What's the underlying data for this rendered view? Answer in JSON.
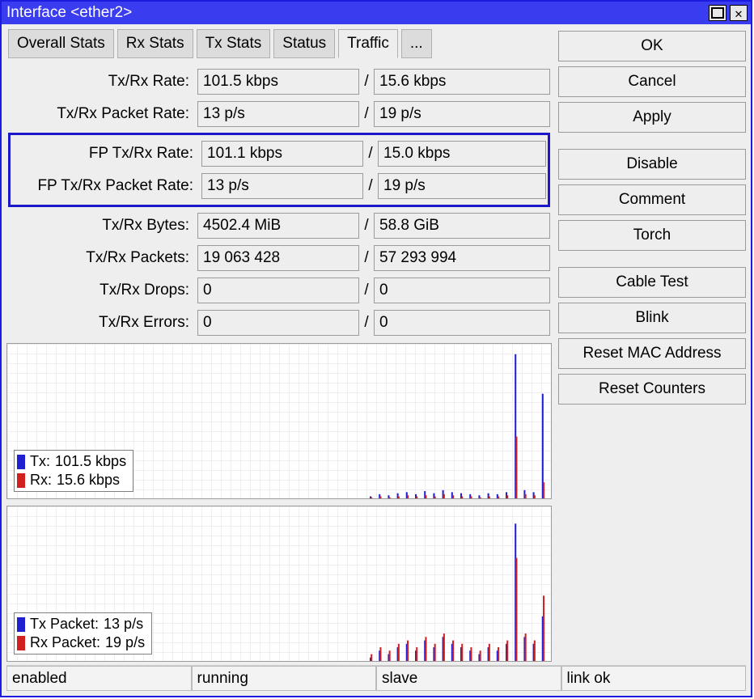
{
  "window": {
    "title": "Interface <ether2>"
  },
  "tabs": {
    "items": [
      "Overall Stats",
      "Rx Stats",
      "Tx Stats",
      "Status",
      "Traffic",
      "..."
    ],
    "active": "Traffic"
  },
  "stats": {
    "txrx_rate": {
      "label": "Tx/Rx Rate:",
      "tx": "101.5 kbps",
      "rx": "15.6 kbps"
    },
    "txrx_packet_rate": {
      "label": "Tx/Rx Packet Rate:",
      "tx": "13 p/s",
      "rx": "19 p/s"
    },
    "fp_txrx_rate": {
      "label": "FP Tx/Rx Rate:",
      "tx": "101.1 kbps",
      "rx": "15.0 kbps"
    },
    "fp_txrx_packet_rate": {
      "label": "FP Tx/Rx Packet Rate:",
      "tx": "13 p/s",
      "rx": "19 p/s"
    },
    "txrx_bytes": {
      "label": "Tx/Rx Bytes:",
      "tx": "4502.4 MiB",
      "rx": "58.8 GiB"
    },
    "txrx_packets": {
      "label": "Tx/Rx Packets:",
      "tx": "19 063 428",
      "rx": "57 293 994"
    },
    "txrx_drops": {
      "label": "Tx/Rx Drops:",
      "tx": "0",
      "rx": "0"
    },
    "txrx_errors": {
      "label": "Tx/Rx Errors:",
      "tx": "0",
      "rx": "0"
    }
  },
  "buttons": {
    "ok": "OK",
    "cancel": "Cancel",
    "apply": "Apply",
    "disable": "Disable",
    "comment": "Comment",
    "torch": "Torch",
    "cable_test": "Cable Test",
    "blink": "Blink",
    "reset_mac": "Reset MAC Address",
    "reset_counters": "Reset Counters"
  },
  "chart1": {
    "legend": {
      "tx_label": "Tx:",
      "tx_value": "101.5 kbps",
      "rx_label": "Rx:",
      "rx_value": "15.6 kbps"
    }
  },
  "chart2": {
    "legend": {
      "tx_label": "Tx Packet:",
      "tx_value": "13 p/s",
      "rx_label": "Rx Packet:",
      "rx_value": "19 p/s"
    }
  },
  "status": {
    "cell0": "enabled",
    "cell1": "running",
    "cell2": "slave",
    "cell3": "link ok"
  },
  "chart_data": [
    {
      "type": "line",
      "title": "",
      "xlabel": "",
      "ylabel": "",
      "x": [
        0,
        1,
        2,
        3,
        4,
        5,
        6,
        7,
        8,
        9,
        10,
        11,
        12,
        13,
        14,
        15,
        16,
        17,
        18,
        19,
        20,
        21,
        22,
        23,
        24,
        25,
        26,
        27,
        28,
        29,
        30,
        31,
        32,
        33,
        34,
        35,
        36,
        37,
        38,
        39,
        40,
        41,
        42,
        43,
        44,
        45,
        46,
        47,
        48,
        49,
        50,
        51,
        52,
        53,
        54,
        55,
        56,
        57,
        58,
        59
      ],
      "series": [
        {
          "name": "Tx (kbps)",
          "color": "#2020d0",
          "values": [
            0,
            0,
            0,
            0,
            0,
            0,
            0,
            0,
            0,
            0,
            0,
            0,
            0,
            0,
            0,
            0,
            0,
            0,
            0,
            0,
            0,
            0,
            0,
            0,
            0,
            0,
            0,
            0,
            0,
            0,
            0,
            0,
            0,
            0,
            0,
            0,
            0,
            0,
            0,
            0,
            2,
            4,
            3,
            5,
            6,
            4,
            7,
            5,
            8,
            6,
            5,
            4,
            3,
            5,
            4,
            6,
            140,
            8,
            6,
            101.5
          ]
        },
        {
          "name": "Rx (kbps)",
          "color": "#d02020",
          "values": [
            0,
            0,
            0,
            0,
            0,
            0,
            0,
            0,
            0,
            0,
            0,
            0,
            0,
            0,
            0,
            0,
            0,
            0,
            0,
            0,
            0,
            0,
            0,
            0,
            0,
            0,
            0,
            0,
            0,
            0,
            0,
            0,
            0,
            0,
            0,
            0,
            0,
            0,
            0,
            0,
            1,
            2,
            1,
            2,
            3,
            2,
            3,
            2,
            4,
            3,
            2,
            2,
            1,
            2,
            2,
            3,
            60,
            4,
            3,
            15.6
          ]
        }
      ],
      "ylim": [
        0,
        150
      ]
    },
    {
      "type": "line",
      "title": "",
      "xlabel": "",
      "ylabel": "",
      "x": [
        0,
        1,
        2,
        3,
        4,
        5,
        6,
        7,
        8,
        9,
        10,
        11,
        12,
        13,
        14,
        15,
        16,
        17,
        18,
        19,
        20,
        21,
        22,
        23,
        24,
        25,
        26,
        27,
        28,
        29,
        30,
        31,
        32,
        33,
        34,
        35,
        36,
        37,
        38,
        39,
        40,
        41,
        42,
        43,
        44,
        45,
        46,
        47,
        48,
        49,
        50,
        51,
        52,
        53,
        54,
        55,
        56,
        57,
        58,
        59
      ],
      "series": [
        {
          "name": "Tx Packet (p/s)",
          "color": "#2020d0",
          "values": [
            0,
            0,
            0,
            0,
            0,
            0,
            0,
            0,
            0,
            0,
            0,
            0,
            0,
            0,
            0,
            0,
            0,
            0,
            0,
            0,
            0,
            0,
            0,
            0,
            0,
            0,
            0,
            0,
            0,
            0,
            0,
            0,
            0,
            0,
            0,
            0,
            0,
            0,
            0,
            0,
            1,
            3,
            2,
            4,
            5,
            3,
            6,
            4,
            7,
            5,
            4,
            3,
            2,
            4,
            3,
            5,
            40,
            7,
            5,
            13
          ]
        },
        {
          "name": "Rx Packet (p/s)",
          "color": "#d02020",
          "values": [
            0,
            0,
            0,
            0,
            0,
            0,
            0,
            0,
            0,
            0,
            0,
            0,
            0,
            0,
            0,
            0,
            0,
            0,
            0,
            0,
            0,
            0,
            0,
            0,
            0,
            0,
            0,
            0,
            0,
            0,
            0,
            0,
            0,
            0,
            0,
            0,
            0,
            0,
            0,
            0,
            2,
            4,
            3,
            5,
            6,
            4,
            7,
            5,
            8,
            6,
            5,
            4,
            3,
            5,
            4,
            6,
            30,
            8,
            6,
            19
          ]
        }
      ],
      "ylim": [
        0,
        45
      ]
    }
  ]
}
